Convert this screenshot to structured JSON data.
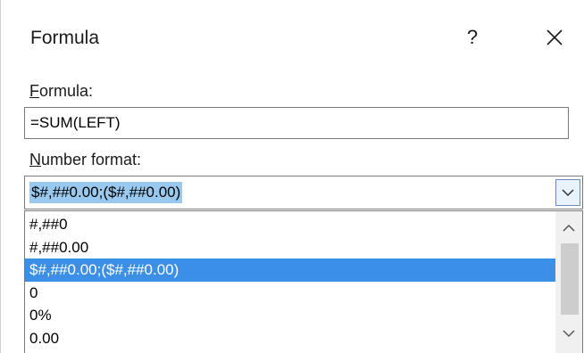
{
  "dialog": {
    "title": "Formula",
    "help_label": "?",
    "close_icon": "close-icon"
  },
  "formula": {
    "label_accel": "F",
    "label_rest": "ormula:",
    "value": "=SUM(LEFT)"
  },
  "number_format": {
    "label_accel": "N",
    "label_rest": "umber format:",
    "selected_value": "$#,##0.00;($#,##0.00)",
    "dropdown_icon": "chevron-down-icon",
    "options": [
      "#,##0",
      "#,##0.00",
      "$#,##0.00;($#,##0.00)",
      "0",
      "0%",
      "0.00"
    ],
    "selected_index": 2,
    "scroll_up_icon": "scroll-up-arrow-icon",
    "scroll_down_icon": "scroll-down-arrow-icon"
  },
  "colors": {
    "highlight": "#3c8fe6",
    "text_selection": "#99c9ef",
    "dropdown_button": "#e8f2fb"
  }
}
